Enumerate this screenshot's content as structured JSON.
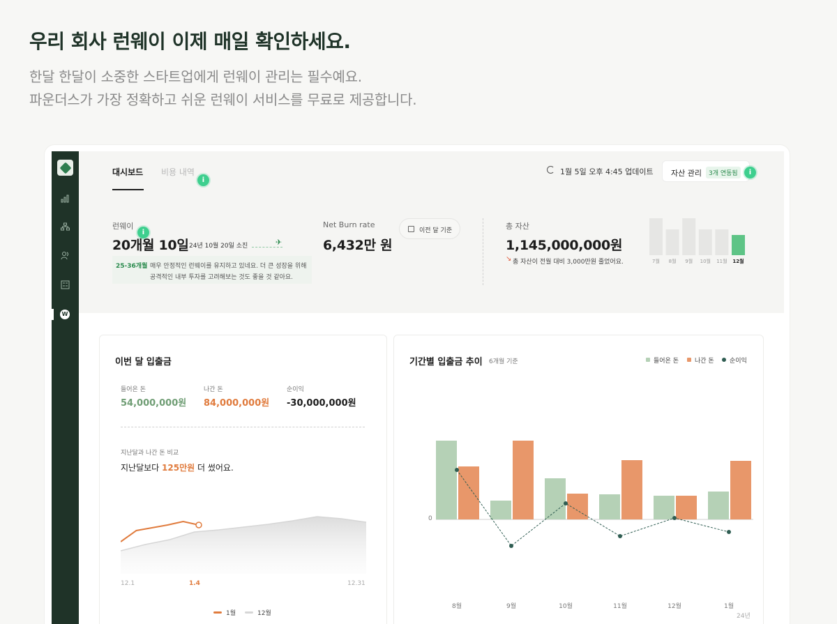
{
  "hero": {
    "title": "우리 회사 런웨이 이제 매일 확인하세요.",
    "sub1": "한달 한달이 소중한 스타트업에게 런웨이 관리는 필수예요.",
    "sub2": "파운더스가 가장 정확하고 쉬운 런웨이 서비스를 무료로 제공합니다."
  },
  "tabs": {
    "active": "대시보드",
    "inactive": "비용 내역"
  },
  "update_text": "1월 5일 오후 4:45 업데이트",
  "asset_button": {
    "label": "자산 관리",
    "badge": "3개 연동됨"
  },
  "info_glyph": "i",
  "runway": {
    "label": "런웨이",
    "value": "20개월 10일",
    "depletion": "24년 10월 20일 소진",
    "badge": "25-36개월",
    "note_line1": "매우 안정적인 런웨이를 유지하고 있네요. 더 큰 성장을 위해",
    "note_line2": "공격적인 내부 투자를 고려해보는 것도 좋을 것 같아요."
  },
  "burn": {
    "label": "Net Burn rate",
    "value": "6,432만 원",
    "prev_button": "이전 달 기준"
  },
  "assets": {
    "label": "총 자산",
    "value": "1,145,000,000원",
    "change": "총 자산이 전월 대비 3,000만원 줄었어요.",
    "months": [
      "7월",
      "8월",
      "9월",
      "10월",
      "11월",
      "12월"
    ],
    "highlight_index": 5
  },
  "mini_chart_data": {
    "type": "bar",
    "categories": [
      "7월",
      "8월",
      "9월",
      "10월",
      "11월",
      "12월"
    ],
    "values": [
      53,
      37,
      53,
      37,
      37,
      29
    ]
  },
  "monthly_card": {
    "title": "이번 달 입출금",
    "in_label": "들어온 돈",
    "in_value": "54,000,000원",
    "out_label": "나간 돈",
    "out_value": "84,000,000원",
    "net_label": "순이익",
    "net_value": "-30,000,000원",
    "compare_head": "지난달과 나간 돈 비교",
    "compare_pre": "지난달보다 ",
    "compare_hl": "125만원",
    "compare_post": " 더 썼어요.",
    "x_labels": [
      "12.1",
      "1.4",
      "12.31"
    ],
    "legend_current": "1월",
    "legend_prev": "12월"
  },
  "line_chart_data": {
    "type": "line",
    "series": [
      {
        "name": "1월",
        "color": "#e07b3d",
        "values": [
          46,
          62,
          66,
          70,
          75,
          70
        ]
      },
      {
        "name": "12월",
        "color": "#d6d6d6",
        "values": [
          33,
          42,
          49,
          60,
          63,
          67,
          71,
          76,
          82,
          79,
          74
        ]
      }
    ]
  },
  "trend_card": {
    "title": "기간별 입출금 추이",
    "subtitle": "6개월 기준",
    "legend_in": "들어온 돈",
    "legend_out": "나간 돈",
    "legend_net": "순이익",
    "zero_label": "0",
    "year_label": "24년"
  },
  "chart_data": {
    "type": "bar",
    "categories": [
      "8월",
      "9월",
      "10월",
      "11월",
      "12월",
      "1월"
    ],
    "series": [
      {
        "name": "들어온 돈",
        "color": "#b5d1b6",
        "values": [
          113,
          27,
          59,
          36,
          34,
          40
        ]
      },
      {
        "name": "나간 돈",
        "color": "#e8976a",
        "values": [
          76,
          113,
          37,
          85,
          34,
          84
        ]
      },
      {
        "name": "순이익",
        "color": "#2f5d52",
        "values": [
          71,
          -38,
          23,
          -24,
          2,
          -18
        ]
      }
    ],
    "zero_line": true
  },
  "colors": {
    "brand": "#1f3328",
    "accent_green": "#3ecf8e",
    "in": "#b5d1b6",
    "out": "#e8976a",
    "net": "#2f5d52"
  }
}
